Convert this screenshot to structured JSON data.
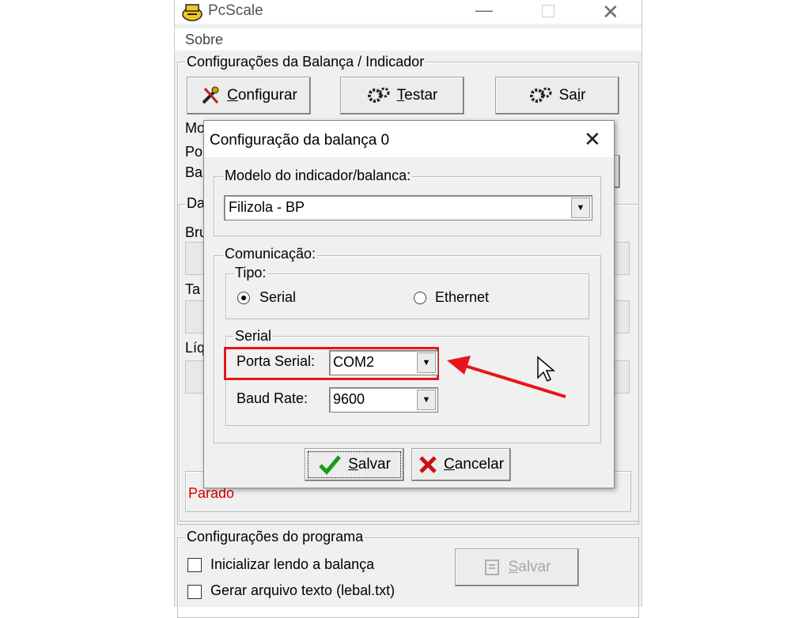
{
  "main_window": {
    "title": "PcScale",
    "menu": {
      "sobre": "Sobre"
    },
    "scale_group": {
      "legend": "Configurações da Balança / Indicador",
      "configurar_u": "C",
      "configurar_rest": "onfigurar",
      "testar_u": "T",
      "testar_rest": "estar",
      "sair_pre": "Sa",
      "sair_u": "i",
      "sair_post": "r"
    },
    "partial_labels": {
      "mo": "Mo",
      "po": "Po",
      "ba": "Ba",
      "da": "Da",
      "bru": "Bru",
      "ta": "Ta",
      "liq": "Líq"
    },
    "status": {
      "text": "Parado",
      "color": "#d40000"
    },
    "program_group": {
      "legend": "Configurações do programa",
      "cb1_label": "Inicializar lendo a balança",
      "cb2_label": "Gerar arquivo texto (lebal.txt)",
      "salvar_u": "S",
      "salvar_rest": "alvar"
    }
  },
  "dialog": {
    "title": "Configuração da balança 0",
    "modelo": {
      "legend": "Modelo do indicador/balanca:",
      "selected": "Filizola - BP"
    },
    "comunicacao": {
      "legend": "Comunicação:",
      "tipo": {
        "legend": "Tipo:",
        "serial": "Serial",
        "ethernet": "Ethernet",
        "selected": "Serial"
      },
      "serial_group": {
        "legend": "Serial",
        "porta_label": "Porta Serial:",
        "porta_value": "COM2",
        "baud_label": "Baud Rate:",
        "baud_value": "9600"
      }
    },
    "buttons": {
      "salvar_u": "S",
      "salvar_rest": "alvar",
      "cancelar_u": "C",
      "cancelar_rest": "ancelar"
    }
  },
  "annotation": {
    "highlight_color": "#e8141a"
  }
}
